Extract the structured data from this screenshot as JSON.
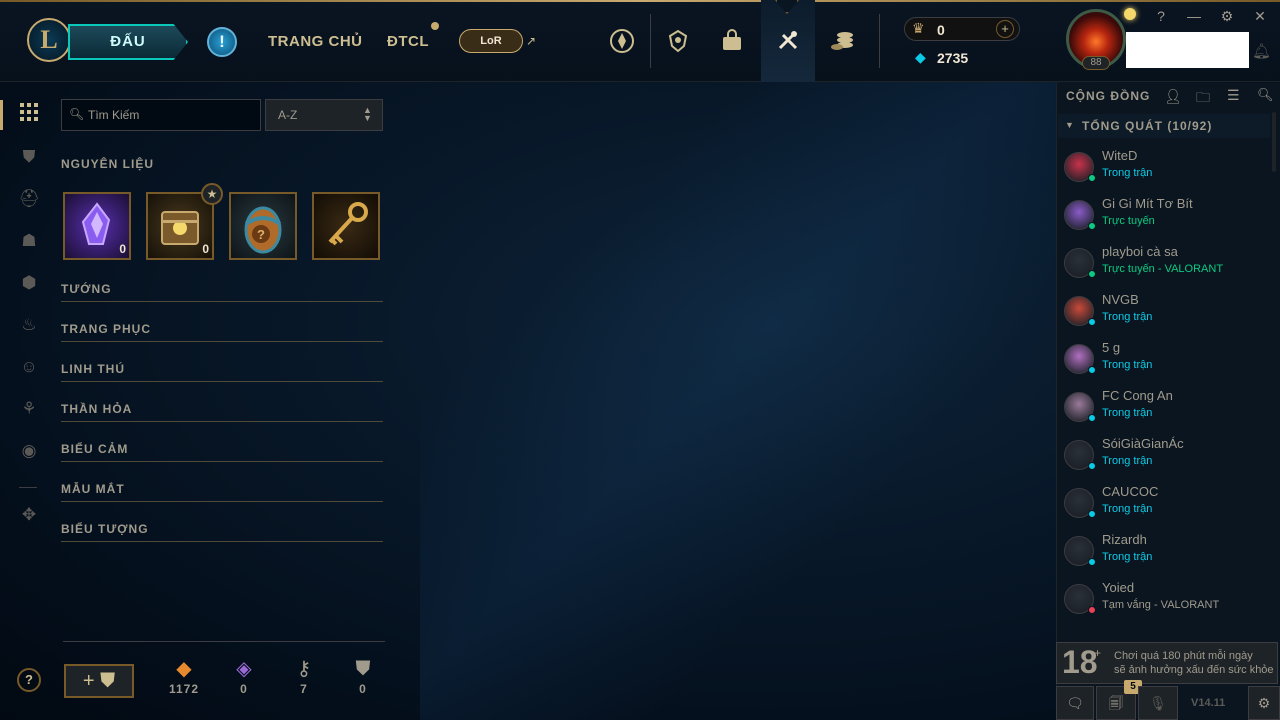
{
  "header": {
    "logo_letter": "L",
    "play_label": "ĐẤU",
    "alert_icon": "!",
    "nav": [
      "TRANG CHỦ",
      "ĐTCL"
    ],
    "lor_label": "LoR",
    "external_icon": "↗",
    "blue_essence_display": "0",
    "currency_add_icon": "+",
    "orange_value": "2735",
    "level": "88",
    "window": {
      "help": "?",
      "minimize": "—",
      "settings": "⚙",
      "close": "✕"
    },
    "nav_icons": [
      "clash-icon",
      "tft-icon",
      "store-icon",
      "collection-icon",
      "loot-icon"
    ]
  },
  "left_rail": [
    "grid-icon",
    "chest-icon",
    "helmet-icon",
    "mask-icon",
    "ward-icon",
    "emote-flame-icon",
    "smile-icon",
    "tree-icon",
    "profile-icon",
    "arrow-icon"
  ],
  "loot": {
    "search_placeholder": "Tìm Kiếm",
    "sort_value": "A-Z",
    "materials_title": "NGUYÊN LIỆU",
    "items": [
      {
        "name": "essence-shard-icon",
        "count": "0",
        "color": "#7a4bd6"
      },
      {
        "name": "chest-icon",
        "count": "0",
        "color": "#b8862d"
      },
      {
        "name": "mystery-egg-icon",
        "count": "",
        "color": "#3d8aa0"
      },
      {
        "name": "key-icon",
        "count": "",
        "color": "#c9973a"
      }
    ],
    "sections": [
      "TƯỚNG",
      "TRANG PHỤC",
      "LINH THÚ",
      "THẦN HỎA",
      "BIỂU CẢM",
      "MẪU MẮT",
      "BIỂU TƯỢNG"
    ],
    "help_icon": "?",
    "craft_button": "+ ⛊",
    "resources": [
      {
        "name": "orange-essence-icon",
        "value": "1172",
        "color": "#e78a2f",
        "glyph": "◆"
      },
      {
        "name": "mythic-essence-icon",
        "value": "0",
        "color": "#9b6ad6",
        "glyph": "◈"
      },
      {
        "name": "key-fragment-icon",
        "value": "7",
        "color": "#a09b8c",
        "glyph": "⚷"
      },
      {
        "name": "chest-count-icon",
        "value": "0",
        "color": "#a09b8c",
        "glyph": "⛊"
      }
    ]
  },
  "social": {
    "title": "CỘNG ĐỒNG",
    "group_label": "TỔNG QUÁT (10/92)",
    "friends": [
      {
        "name": "WiteD",
        "status": "Trong trận",
        "status_color": "#0acbe6",
        "dot": "#0acb81",
        "avatar": "#c8324a"
      },
      {
        "name": "Gi Gi Mít Tơ Bít",
        "status": "Trực tuyến",
        "status_color": "#0acb81",
        "dot": "#0acb81",
        "avatar": "#8a5cc8"
      },
      {
        "name": "playboi cà sa",
        "status": "Trực tuyến - VALORANT",
        "status_color": "#0acb81",
        "dot": "#0acb81",
        "avatar": "#2a3038"
      },
      {
        "name": "NVGB",
        "status": "Trong trận",
        "status_color": "#0acbe6",
        "dot": "#0acbe6",
        "avatar": "#c84a3a"
      },
      {
        "name": "5 g",
        "status": "Trong trận",
        "status_color": "#0acbe6",
        "dot": "#0acbe6",
        "avatar": "#b070c0"
      },
      {
        "name": "FC Cong An",
        "status": "Trong trận",
        "status_color": "#0acbe6",
        "dot": "#0acbe6",
        "avatar": "#9a7a9a"
      },
      {
        "name": "SóiGiàGianÁc",
        "status": "Trong trận",
        "status_color": "#0acbe6",
        "dot": "#0acbe6",
        "avatar": "#2a3038"
      },
      {
        "name": "CAUCOC",
        "status": "Trong trận",
        "status_color": "#0acbe6",
        "dot": "#0acbe6",
        "avatar": "#2a3038"
      },
      {
        "name": "Rizardh",
        "status": "Trong trận",
        "status_color": "#0acbe6",
        "dot": "#0acbe6",
        "avatar": "#2a3038"
      },
      {
        "name": "Yoied",
        "status": "Tạm vắng - VALORANT",
        "status_color": "#a09b8c",
        "dot": "#e84057",
        "avatar": "#2a3038"
      }
    ],
    "age_rating": "18",
    "warning_line1": "Chơi quá 180 phút mỗi ngày",
    "warning_line2": "sẽ ảnh hưởng xấu đến sức khỏe",
    "badge_count": "5",
    "version": "V14.11"
  }
}
